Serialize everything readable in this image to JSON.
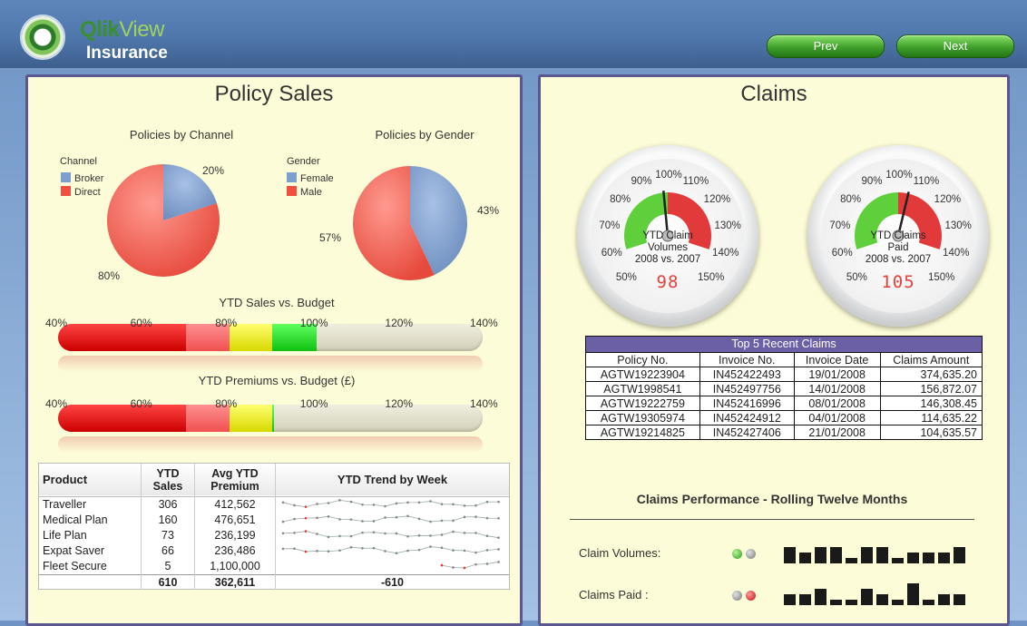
{
  "header": {
    "logo_text_1": "Qlik",
    "logo_text_2": "View",
    "subtitle": "Insurance",
    "prev_label": "Prev",
    "next_label": "Next"
  },
  "colors": {
    "broker": "#7d9fcf",
    "direct": "#f05040",
    "red": "#dd1a1a",
    "pink": "#ff6b6b",
    "yellow": "#f0f020",
    "green": "#22dd22",
    "panel_bg": "#fdfcd8",
    "panel_border": "#5b5590",
    "table_header": "#6b5fa6"
  },
  "policy_sales": {
    "title": "Policy Sales",
    "by_channel": {
      "title": "Policies by Channel",
      "legend_title": "Channel",
      "legend": [
        "Broker",
        "Direct"
      ],
      "pct_broker": "20%",
      "pct_direct": "80%"
    },
    "by_gender": {
      "title": "Policies by Gender",
      "legend_title": "Gender",
      "legend": [
        "Female",
        "Male"
      ],
      "pct_female": "43%",
      "pct_male": "57%"
    },
    "sales_vs_budget": {
      "title": "YTD Sales vs. Budget",
      "ticks": [
        "40%",
        "60%",
        "80%",
        "100%",
        "120%",
        "140%"
      ],
      "value_pct": 100
    },
    "premiums_vs_budget": {
      "title": "YTD Premiums vs. Budget (£)",
      "ticks": [
        "40%",
        "60%",
        "80%",
        "100%",
        "120%",
        "140%"
      ],
      "value_pct": 90
    },
    "table": {
      "headers": {
        "product": "Product",
        "ytd_sales_1": "YTD",
        "ytd_sales_2": "Sales",
        "avg_1": "Avg YTD",
        "avg_2": "Premium",
        "trend": "YTD Trend by Week"
      },
      "rows": [
        {
          "product": "Traveller",
          "sales": "306",
          "premium": "412,562"
        },
        {
          "product": "Medical Plan",
          "sales": "160",
          "premium": "476,651"
        },
        {
          "product": "Life Plan",
          "sales": "73",
          "premium": "236,199"
        },
        {
          "product": "Expat Saver",
          "sales": "66",
          "premium": "236,486"
        },
        {
          "product": "Fleet Secure",
          "sales": "5",
          "premium": "1,100,000"
        }
      ],
      "totals": {
        "sales": "610",
        "premium": "362,611",
        "trend": "-610"
      }
    }
  },
  "claims": {
    "title": "Claims",
    "gauge_labels": [
      "50%",
      "60%",
      "70%",
      "80%",
      "90%",
      "100%",
      "110%",
      "120%",
      "130%",
      "140%",
      "150%"
    ],
    "gauge1": {
      "cap_1": "YTD Claim",
      "cap_2": "Volumes",
      "cap_3": "2008 vs. 2007",
      "value": "98",
      "value_pct": 98
    },
    "gauge2": {
      "cap_1": "YTD Claims",
      "cap_2": "Paid",
      "cap_3": "2008 vs. 2007",
      "value": "105",
      "value_pct": 105
    },
    "recent": {
      "title": "Top 5 Recent Claims",
      "headers": [
        "Policy No.",
        "Invoice No.",
        "Invoice Date",
        "Claims Amount"
      ],
      "rows": [
        [
          "AGTW19223904",
          "IN452422493",
          "19/01/2008",
          "374,635.20"
        ],
        [
          "AGTW1998541",
          "IN452497756",
          "14/01/2008",
          "156,872.07"
        ],
        [
          "AGTW19222759",
          "IN452416996",
          "08/01/2008",
          "146,308.45"
        ],
        [
          "AGTW19305974",
          "IN452424912",
          "04/01/2008",
          "114,635.22"
        ],
        [
          "AGTW19214825",
          "IN452427406",
          "21/01/2008",
          "104,635.57"
        ]
      ]
    },
    "performance": {
      "title": "Claims Performance - Rolling Twelve Months",
      "rows": [
        {
          "label": "Claim Volumes:",
          "led": [
            "green",
            "grey"
          ],
          "bars": [
            3,
            2,
            3,
            3,
            1,
            3,
            3,
            1,
            2,
            2,
            2,
            3
          ]
        },
        {
          "label": "Claims Paid :",
          "led": [
            "grey",
            "red"
          ],
          "bars": [
            2,
            2,
            3,
            1,
            1,
            3,
            2,
            1,
            4,
            1,
            2,
            2
          ]
        }
      ]
    }
  }
}
